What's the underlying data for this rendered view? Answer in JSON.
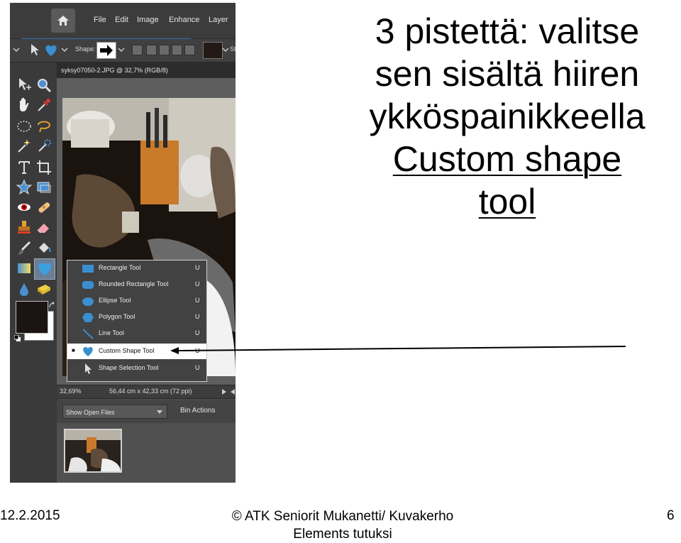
{
  "app": {
    "menu": [
      "File",
      "Edit",
      "Image",
      "Enhance",
      "Layer"
    ],
    "options_label": "Shape:",
    "options_trailing": "St",
    "document_title": "syksy07050-2.JPG @ 32,7% (RGB/8)",
    "status": {
      "zoom": "32,69%",
      "size": "56,44 cm x 42,33 cm (72 ppi)"
    },
    "bin": {
      "dropdown": "Show Open Files",
      "actions": "Bin Actions"
    }
  },
  "flyout": {
    "items": [
      {
        "label": "Rectangle Tool",
        "key": "U",
        "icon": "rectangle-icon"
      },
      {
        "label": "Rounded Rectangle Tool",
        "key": "U",
        "icon": "rounded-rectangle-icon"
      },
      {
        "label": "Ellipse Tool",
        "key": "U",
        "icon": "ellipse-icon"
      },
      {
        "label": "Polygon Tool",
        "key": "U",
        "icon": "polygon-icon"
      },
      {
        "label": "Line Tool",
        "key": "U",
        "icon": "line-icon"
      },
      {
        "label": "Custom Shape Tool",
        "key": "U",
        "icon": "heart-icon",
        "selected": true
      },
      {
        "label": "Shape Selection Tool",
        "key": "U",
        "icon": "arrow-cursor-icon"
      }
    ]
  },
  "callout": {
    "line1": "3 pistettä: valitse",
    "line2": "sen sisältä hiiren",
    "line3": "ykköspainikkeella",
    "line4": "Custom shape",
    "line5": "tool"
  },
  "footer": {
    "date": "12.2.2015",
    "copyright_line1": "© ATK Seniorit Mukanetti/ Kuvakerho",
    "copyright_line2": "Elements tutuksi",
    "page": "6"
  },
  "colors": {
    "accent": "#2f6fb0",
    "shape_blue": "#3a8fd0",
    "foreground_color": "#1c1412",
    "background_color": "#ffffff"
  }
}
